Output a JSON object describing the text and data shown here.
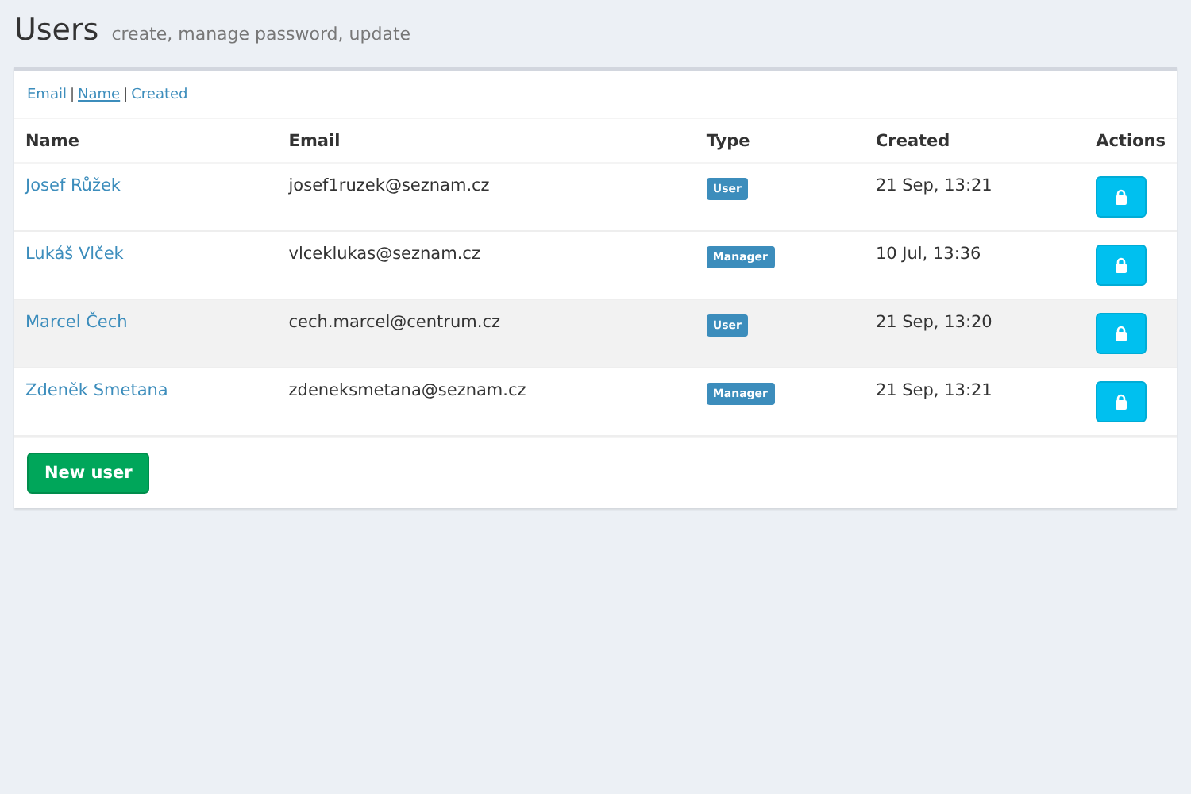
{
  "page": {
    "title": "Users",
    "subtitle": "create, manage password, update"
  },
  "sort_separator": "|",
  "sort_links": [
    {
      "label": "Email",
      "selected": false
    },
    {
      "label": "Name",
      "selected": true
    },
    {
      "label": "Created",
      "selected": false
    }
  ],
  "table": {
    "columns": [
      "Name",
      "Email",
      "Type",
      "Created",
      "Actions"
    ],
    "rows": [
      {
        "name": "Josef Růžek",
        "email": "josef1ruzek@seznam.cz",
        "type": "User",
        "created": "21 Sep, 13:21",
        "highlighted": false
      },
      {
        "name": "Lukáš Vlček",
        "email": "vlceklukas@seznam.cz",
        "type": "Manager",
        "created": "10 Jul, 13:36",
        "highlighted": false
      },
      {
        "name": "Marcel Čech",
        "email": "cech.marcel@centrum.cz",
        "type": "User",
        "created": "21 Sep, 13:20",
        "highlighted": true
      },
      {
        "name": "Zdeněk Smetana",
        "email": "zdeneksmetana@seznam.cz",
        "type": "Manager",
        "created": "21 Sep, 13:21",
        "highlighted": false
      }
    ]
  },
  "new_user_button": "New user"
}
